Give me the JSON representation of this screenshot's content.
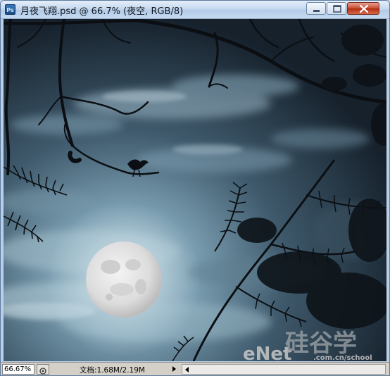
{
  "window": {
    "title": "月夜飞翔.psd @ 66.7% (夜空, RGB/8)",
    "app_icon": "ps-icon",
    "app_icon_text": "Ps",
    "buttons": [
      "minimize-icon",
      "maximize-icon",
      "close-icon"
    ]
  },
  "statusbar": {
    "zoom": "66.67%",
    "doc_info": "文档:1.68M/2.19M",
    "nav_icon": "navigator-icon",
    "menu_icon": "triangle-right-icon",
    "scroll_icon": "scroll-left-icon"
  },
  "canvas": {
    "scene": "night sky with full moon, clouds, tree branches and a bird",
    "watermark": "eNet 硅谷学 .com.cn/school"
  },
  "colors": {
    "sky_dark": "#1b2834",
    "sky_light": "#8fb3c4",
    "moon": "#e6e6e6",
    "title_bar": "#c7daf0",
    "status_bar": "#d4d0c8",
    "close_button": "#c8482e"
  }
}
